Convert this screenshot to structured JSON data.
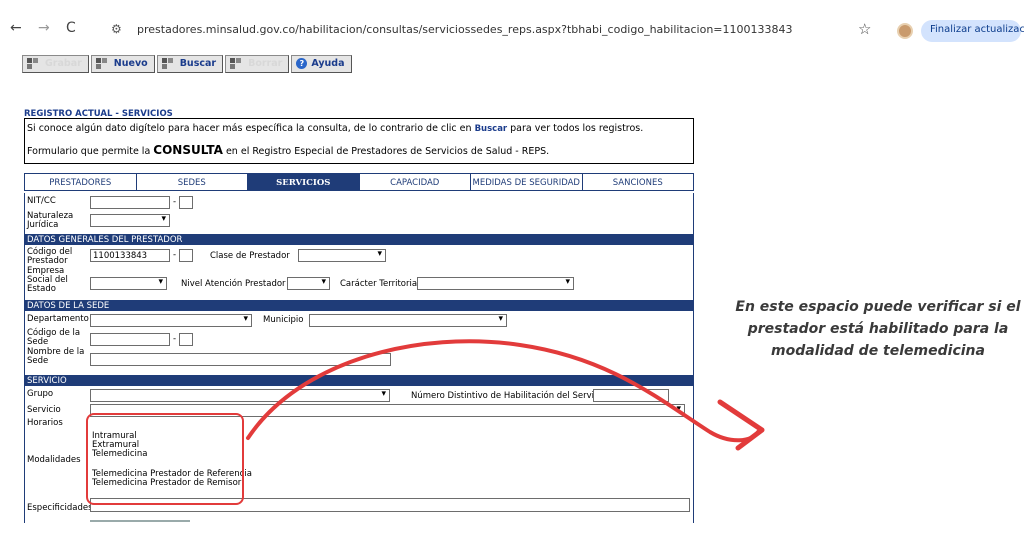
{
  "browser": {
    "url": "prestadores.minsalud.gov.co/habilitacion/consultas/serviciossedes_reps.aspx?tbhabi_codigo_habilitacion=1100133843",
    "update_button": "Finalizar actualización"
  },
  "toolbar": {
    "items": [
      {
        "label": "Grabar",
        "enabled": false
      },
      {
        "label": "Nuevo",
        "enabled": true
      },
      {
        "label": "Buscar",
        "enabled": true
      },
      {
        "label": "Borrar",
        "enabled": false
      },
      {
        "label": "Ayuda",
        "enabled": true
      }
    ]
  },
  "page": {
    "section_title": "REGISTRO ACTUAL - SERVICIOS",
    "info_pre": "Si conoce algún dato digítelo para hacer más específica la consulta, de lo contrario de clic en ",
    "info_link": "Buscar",
    "info_post": " para ver todos los registros.",
    "form_pre": "Formulario que permite la ",
    "form_bold": "CONSULTA",
    "form_post": " en el Registro Especial de Prestadores de Servicios de Salud - REPS."
  },
  "tabs": [
    "PRESTADORES",
    "SEDES",
    "SERVICIOS",
    "CAPACIDAD",
    "MEDIDAS DE SEGURIDAD",
    "SANCIONES"
  ],
  "form": {
    "nit_label": "NIT/CC",
    "naturaleza_label": "Naturaleza Jurídica",
    "sect_prestador": "DATOS GENERALES DEL PRESTADOR",
    "codigo_prestador_label": "Código del Prestador",
    "codigo_prestador_value": "1100133843",
    "clase_label": "Clase de Prestador",
    "empresa_label": "Empresa Social del Estado",
    "nivel_label": "Nivel Atención Prestador",
    "caracter_label": "Carácter Territorial",
    "sect_sede": "DATOS DE LA SEDE",
    "departamento_label": "Departamento",
    "municipio_label": "Municipio",
    "codigo_sede_label": "Código de la Sede",
    "nombre_sede_label": "Nombre de la Sede",
    "sect_servicio": "SERVICIO",
    "grupo_label": "Grupo",
    "numero_distintivo_label": "Número Distintivo de Habilitación del Servicio",
    "servicio_label": "Servicio",
    "horarios_label": "Horarios",
    "modalidades_label": "Modalidades",
    "modalidades": [
      "Intramural",
      "Extramural",
      "Telemedicina",
      "Telemedicina Prestador de Referencia",
      "Telemedicina Prestador de Remisor"
    ],
    "especificidades_label": "Especificidades",
    "dash": "-"
  },
  "annotation": {
    "text": "En este espacio puede verificar si el prestador está habilitado para la modalidad de telemedicina",
    "color": "#e23b3b"
  }
}
